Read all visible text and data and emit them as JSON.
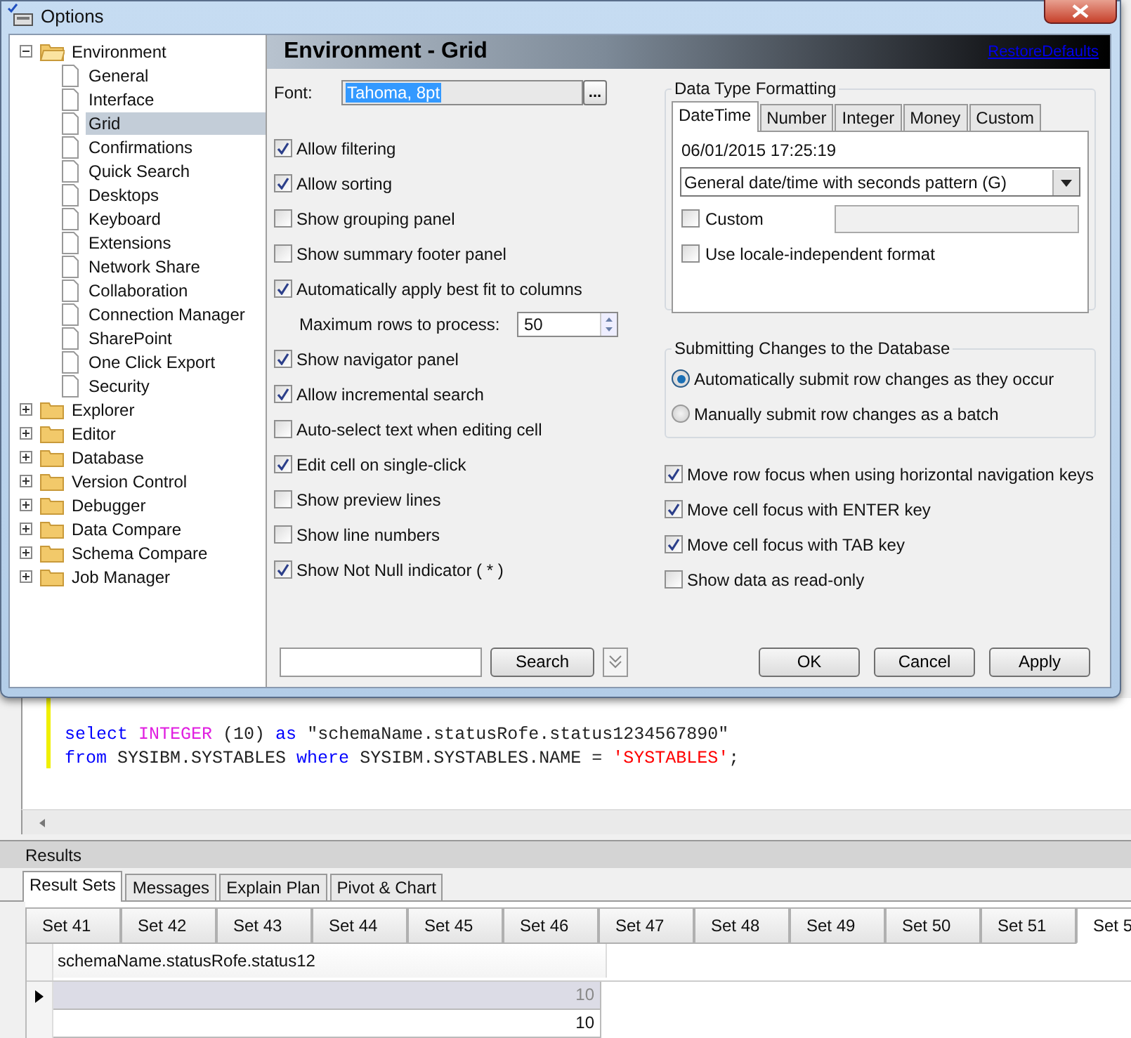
{
  "window": {
    "title": "Options"
  },
  "tree": [
    {
      "label": "Environment",
      "expanded": true,
      "selected": false,
      "children": [
        {
          "label": "General",
          "selected": false
        },
        {
          "label": "Interface",
          "selected": false
        },
        {
          "label": "Grid",
          "selected": true
        },
        {
          "label": "Confirmations",
          "selected": false
        },
        {
          "label": "Quick Search",
          "selected": false
        },
        {
          "label": "Desktops",
          "selected": false
        },
        {
          "label": "Keyboard",
          "selected": false
        },
        {
          "label": "Extensions",
          "selected": false
        },
        {
          "label": "Network Share",
          "selected": false
        },
        {
          "label": "Collaboration",
          "selected": false
        },
        {
          "label": "Connection Manager",
          "selected": false
        },
        {
          "label": "SharePoint",
          "selected": false
        },
        {
          "label": "One Click Export",
          "selected": false
        },
        {
          "label": "Security",
          "selected": false
        }
      ]
    },
    {
      "label": "Explorer",
      "expanded": false,
      "selected": false
    },
    {
      "label": "Editor",
      "expanded": false,
      "selected": false
    },
    {
      "label": "Database",
      "expanded": false,
      "selected": false
    },
    {
      "label": "Version Control",
      "expanded": false,
      "selected": false
    },
    {
      "label": "Debugger",
      "expanded": false,
      "selected": false
    },
    {
      "label": "Data Compare",
      "expanded": false,
      "selected": false
    },
    {
      "label": "Schema Compare",
      "expanded": false,
      "selected": false
    },
    {
      "label": "Job Manager",
      "expanded": false,
      "selected": false
    }
  ],
  "page_title": "Environment - Grid",
  "restore_link": "RestoreDefaults",
  "font": {
    "label": "Font:",
    "value": "Tahoma, 8pt",
    "button": "..."
  },
  "options_left": [
    {
      "kind": "checkbox",
      "label": "Allow filtering",
      "checked": true
    },
    {
      "kind": "checkbox",
      "label": "Allow sorting",
      "checked": true
    },
    {
      "kind": "checkbox",
      "label": "Show grouping panel",
      "checked": false
    },
    {
      "kind": "checkbox",
      "label": "Show summary footer panel",
      "checked": false
    },
    {
      "kind": "checkbox",
      "label": "Automatically apply best fit to columns",
      "checked": true
    },
    {
      "kind": "number",
      "label": "Maximum rows to process:",
      "value": "50"
    },
    {
      "kind": "checkbox",
      "label": "Show navigator panel",
      "checked": true
    },
    {
      "kind": "checkbox",
      "label": "Allow incremental search",
      "checked": true
    },
    {
      "kind": "checkbox",
      "label": "Auto-select text when editing cell",
      "checked": false
    },
    {
      "kind": "checkbox",
      "label": "Edit cell on single-click",
      "checked": true
    },
    {
      "kind": "checkbox",
      "label": "Show preview lines",
      "checked": false
    },
    {
      "kind": "checkbox",
      "label": "Show line numbers",
      "checked": false
    },
    {
      "kind": "checkbox",
      "label": "Show Not Null indicator ( * )",
      "checked": true
    }
  ],
  "data_type_formatting": {
    "title": "Data Type Formatting",
    "tabs": [
      {
        "label": "DateTime",
        "selected": true
      },
      {
        "label": "Number",
        "selected": false
      },
      {
        "label": "Integer",
        "selected": false
      },
      {
        "label": "Money",
        "selected": false
      },
      {
        "label": "Custom",
        "selected": false
      }
    ],
    "sample": "06/01/2015 17:25:19",
    "pattern": "General date/time with seconds pattern (G)",
    "custom": {
      "label": "Custom",
      "checked": false
    },
    "locale": {
      "label": "Use locale-independent format",
      "checked": false
    }
  },
  "submitting": {
    "title": "Submitting Changes to the Database",
    "options": [
      {
        "label": "Automatically submit row changes as they occur",
        "selected": true
      },
      {
        "label": "Manually submit row changes as a batch",
        "selected": false
      }
    ]
  },
  "options_right": [
    {
      "label": "Move row focus when using horizontal navigation keys",
      "checked": true
    },
    {
      "label": "Move cell focus with ENTER key",
      "checked": true
    },
    {
      "label": "Move cell focus with TAB key",
      "checked": true
    },
    {
      "label": "Show data as read-only",
      "checked": false
    }
  ],
  "search": {
    "button": "Search"
  },
  "buttons": [
    "OK",
    "Cancel",
    "Apply"
  ],
  "editor": {
    "lines": [
      [
        {
          "kind": "keyword",
          "text": "select "
        },
        {
          "kind": "function",
          "text": "INTEGER"
        },
        {
          "kind": "plain",
          "text": " (10) "
        },
        {
          "kind": "keyword",
          "text": "as"
        },
        {
          "kind": "plain",
          "text": " \"schemaName.statusRofe.status1234567890\""
        }
      ],
      [
        {
          "kind": "keyword",
          "text": "from"
        },
        {
          "kind": "plain",
          "text": " SYSIBM.SYSTABLES "
        },
        {
          "kind": "keyword",
          "text": "where"
        },
        {
          "kind": "plain",
          "text": " SYSIBM.SYSTABLES.NAME = "
        },
        {
          "kind": "string",
          "text": "'SYSTABLES'"
        },
        {
          "kind": "plain",
          "text": ";"
        }
      ]
    ]
  },
  "results": {
    "title": "Results",
    "tabs": [
      {
        "label": "Result Sets",
        "selected": true
      },
      {
        "label": "Messages",
        "selected": false
      },
      {
        "label": "Explain Plan",
        "selected": false
      },
      {
        "label": "Pivot & Chart",
        "selected": false
      }
    ],
    "set_tabs": [
      {
        "label": "Set 41",
        "selected": false
      },
      {
        "label": "Set 42",
        "selected": false
      },
      {
        "label": "Set 43",
        "selected": false
      },
      {
        "label": "Set 44",
        "selected": false
      },
      {
        "label": "Set 45",
        "selected": false
      },
      {
        "label": "Set 46",
        "selected": false
      },
      {
        "label": "Set 47",
        "selected": false
      },
      {
        "label": "Set 48",
        "selected": false
      },
      {
        "label": "Set 49",
        "selected": false
      },
      {
        "label": "Set 50",
        "selected": false
      },
      {
        "label": "Set 51",
        "selected": false
      },
      {
        "label": "Set 5",
        "selected": true
      }
    ],
    "column": "schemaName.statusRofe.status12",
    "rows": [
      {
        "value": "10",
        "selected": true
      },
      {
        "value": "10",
        "selected": false
      }
    ]
  }
}
